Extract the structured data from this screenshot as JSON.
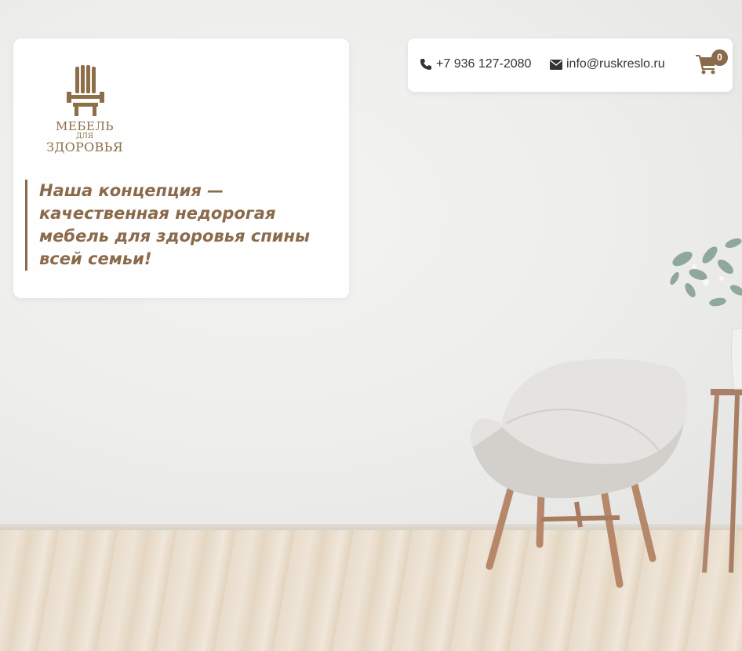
{
  "brand": {
    "line1": "МЕБЕЛЬ",
    "line2": "ДЛЯ",
    "line3": "ЗДОРОВЬЯ",
    "color": "#8c6f48"
  },
  "hero": {
    "tagline": "Наша концепция — качественная недорогая мебель для здоровья спины всей семьи!",
    "accent_color": "#8a6a4a"
  },
  "contacts": {
    "phone": "+7 936 127-2080",
    "phone_icon": "phone-icon",
    "email": "info@ruskreslo.ru",
    "email_icon": "envelope-icon"
  },
  "cart": {
    "icon": "shopping-cart-icon",
    "count": "0",
    "color": "#8a6a4a"
  }
}
